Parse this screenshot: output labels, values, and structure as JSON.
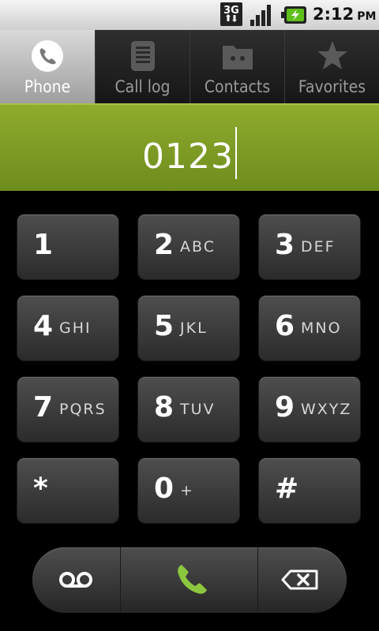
{
  "status_bar": {
    "network_type": "3G",
    "time": "2:12",
    "ampm": "PM",
    "icons": [
      "3g-data-icon",
      "signal-strength-icon",
      "battery-charging-icon"
    ]
  },
  "tabs": [
    {
      "label": "Phone",
      "icon": "phone-icon",
      "active": true
    },
    {
      "label": "Call log",
      "icon": "call-log-icon",
      "active": false
    },
    {
      "label": "Contacts",
      "icon": "contacts-icon",
      "active": false
    },
    {
      "label": "Favorites",
      "icon": "star-icon",
      "active": false
    }
  ],
  "dialed_number": "0123",
  "keypad": [
    {
      "digit": "1",
      "letters": ""
    },
    {
      "digit": "2",
      "letters": "ABC"
    },
    {
      "digit": "3",
      "letters": "DEF"
    },
    {
      "digit": "4",
      "letters": "GHI"
    },
    {
      "digit": "5",
      "letters": "JKL"
    },
    {
      "digit": "6",
      "letters": "MNO"
    },
    {
      "digit": "7",
      "letters": "PQRS"
    },
    {
      "digit": "8",
      "letters": "TUV"
    },
    {
      "digit": "9",
      "letters": "WXYZ"
    },
    {
      "digit": "*",
      "letters": ""
    },
    {
      "digit": "0",
      "letters": "+"
    },
    {
      "digit": "#",
      "letters": ""
    }
  ],
  "bottom_bar": {
    "voicemail_icon": "voicemail-icon",
    "call_icon": "call-icon",
    "delete_icon": "backspace-icon"
  },
  "colors": {
    "display_green": "#7f9d25",
    "call_green": "#8cc63f",
    "active_tab": "#c8c8c8"
  }
}
